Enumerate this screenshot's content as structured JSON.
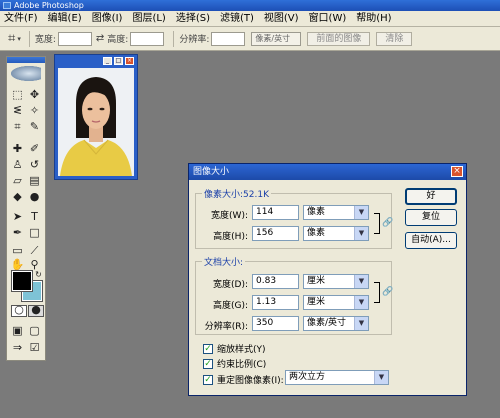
{
  "app": {
    "title": "Adobe Photoshop"
  },
  "menu": [
    "文件(F)",
    "编辑(E)",
    "图像(I)",
    "图层(L)",
    "选择(S)",
    "滤镜(T)",
    "视图(V)",
    "窗口(W)",
    "帮助(H)"
  ],
  "options": {
    "width_label": "宽度:",
    "width_value": "",
    "height_label": "高度:",
    "height_value": "",
    "resolution_label": "分辨率:",
    "resolution_value": "",
    "resolution_unit": "像素/英寸",
    "front_image_btn": "前面的图像",
    "clear_btn": "清除"
  },
  "colors": {
    "foreground": "#000000",
    "background": "#7ec3d6"
  },
  "dialog": {
    "title": "图像大小",
    "pixel_group": {
      "label": "像素大小:52.1K",
      "width_label": "宽度(W):",
      "width_value": "114",
      "width_unit": "像素",
      "height_label": "高度(H):",
      "height_value": "156",
      "height_unit": "像素"
    },
    "doc_group": {
      "label": "文档大小:",
      "width_label": "宽度(D):",
      "width_value": "0.83",
      "width_unit": "厘米",
      "height_label": "高度(G):",
      "height_value": "1.13",
      "height_unit": "厘米",
      "res_label": "分辨率(R):",
      "res_value": "350",
      "res_unit": "像素/英寸"
    },
    "checkboxes": {
      "scale_styles": "缩放样式(Y)",
      "constrain": "约束比例(C)",
      "resample": "重定图像像素(I):"
    },
    "resample_method": "两次立方",
    "buttons": {
      "ok": "好",
      "reset": "复位",
      "auto": "自动(A)..."
    }
  }
}
